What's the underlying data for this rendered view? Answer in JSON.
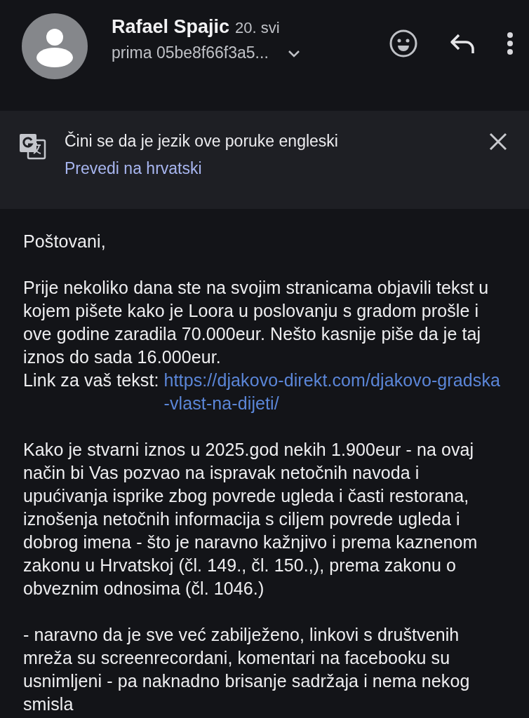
{
  "header": {
    "sender": "Rafael Spajic",
    "date": "20. svi",
    "recipient": "prima 05be8f66f3a5..."
  },
  "translate_banner": {
    "message": "Čini se da je jezik ove poruke engleski",
    "action": "Prevedi na hrvatski"
  },
  "body": [
    {
      "kind": "text",
      "text": "Poštovani,"
    },
    {
      "kind": "link_paragraph",
      "text": "Prije nekoliko dana ste na svojim stranicama objavili tekst u kojem pišete kako je Loora u poslovanju s gradom prošle i ove godine zaradila 70.000eur. Nešto kasnije piše da je taj iznos do sada 16.000eur.",
      "link_label": "Link za vaš tekst:",
      "link": "https://djakovo-direkt.com/djakovo-gradska-vlast-na-dijeti/"
    },
    {
      "kind": "text",
      "text": "Kako je stvarni iznos u 2025.god nekih 1.900eur - na ovaj način bi Vas pozvao na ispravak netočnih navoda i upućivanja isprike zbog povrede ugleda i časti restorana, iznošenja netočnih informacija s ciljem povrede ugleda i dobrog imena - što je naravno kažnjivo i prema kaznenom zakonu u Hrvatskoj (čl. 149., čl. 150.,), prema zakonu o obveznim odnosima (čl. 1046.)"
    },
    {
      "kind": "text",
      "text": "- naravno da je sve već zabilježeno, linkovi s društvenih mreža su screenrecordani, komentari na facebooku su usnimljeni - pa naknadno brisanje sadržaja i nema nekog smisla"
    }
  ]
}
